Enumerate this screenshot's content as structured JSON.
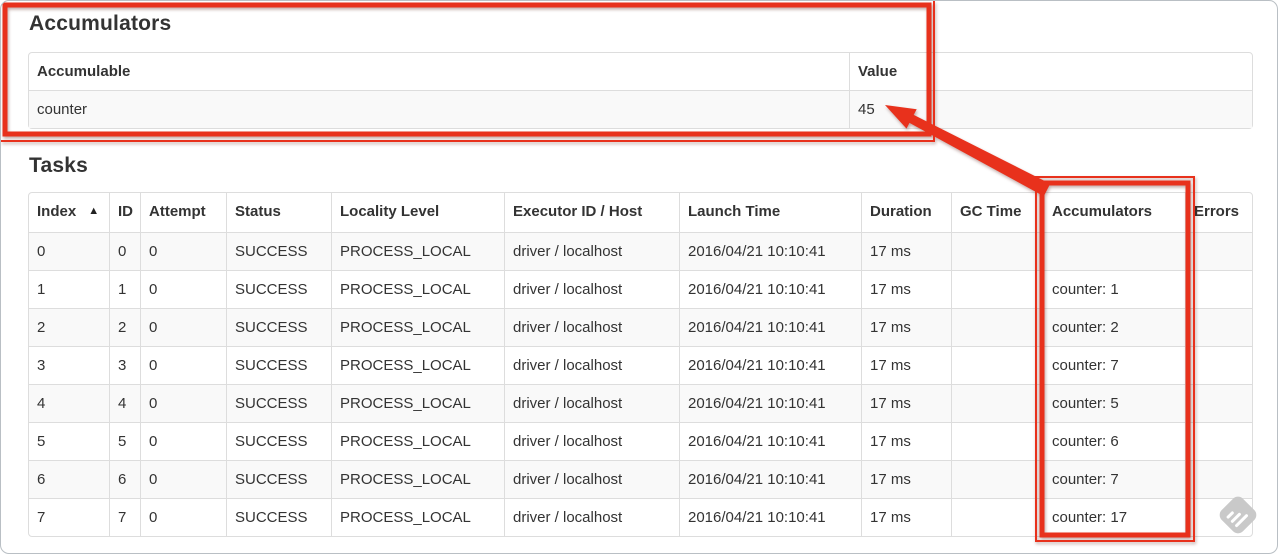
{
  "accumulators_section": {
    "title": "Accumulators",
    "headers": [
      "Accumulable",
      "Value"
    ],
    "rows": [
      [
        "counter",
        "45"
      ]
    ]
  },
  "tasks_section": {
    "title": "Tasks",
    "sort_icon": "▲",
    "headers": [
      "Index",
      "ID",
      "Attempt",
      "Status",
      "Locality Level",
      "Executor ID / Host",
      "Launch Time",
      "Duration",
      "GC Time",
      "Accumulators",
      "Errors"
    ],
    "rows": [
      [
        "0",
        "0",
        "0",
        "SUCCESS",
        "PROCESS_LOCAL",
        "driver / localhost",
        "2016/04/21 10:10:41",
        "17 ms",
        "",
        "",
        ""
      ],
      [
        "1",
        "1",
        "0",
        "SUCCESS",
        "PROCESS_LOCAL",
        "driver / localhost",
        "2016/04/21 10:10:41",
        "17 ms",
        "",
        "counter: 1",
        ""
      ],
      [
        "2",
        "2",
        "0",
        "SUCCESS",
        "PROCESS_LOCAL",
        "driver / localhost",
        "2016/04/21 10:10:41",
        "17 ms",
        "",
        "counter: 2",
        ""
      ],
      [
        "3",
        "3",
        "0",
        "SUCCESS",
        "PROCESS_LOCAL",
        "driver / localhost",
        "2016/04/21 10:10:41",
        "17 ms",
        "",
        "counter: 7",
        ""
      ],
      [
        "4",
        "4",
        "0",
        "SUCCESS",
        "PROCESS_LOCAL",
        "driver / localhost",
        "2016/04/21 10:10:41",
        "17 ms",
        "",
        "counter: 5",
        ""
      ],
      [
        "5",
        "5",
        "0",
        "SUCCESS",
        "PROCESS_LOCAL",
        "driver / localhost",
        "2016/04/21 10:10:41",
        "17 ms",
        "",
        "counter: 6",
        ""
      ],
      [
        "6",
        "6",
        "0",
        "SUCCESS",
        "PROCESS_LOCAL",
        "driver / localhost",
        "2016/04/21 10:10:41",
        "17 ms",
        "",
        "counter: 7",
        ""
      ],
      [
        "7",
        "7",
        "0",
        "SUCCESS",
        "PROCESS_LOCAL",
        "driver / localhost",
        "2016/04/21 10:10:41",
        "17 ms",
        "",
        "counter: 17",
        ""
      ]
    ]
  },
  "annotations": {
    "color": "#e8311c",
    "shapes": [
      "box-around-accumulators-section",
      "box-around-tasks-accumulators-column",
      "arrow-pointing-to-accumulator-value"
    ]
  },
  "watermark": {
    "icon": "skitch-pencil-nib-icon"
  }
}
